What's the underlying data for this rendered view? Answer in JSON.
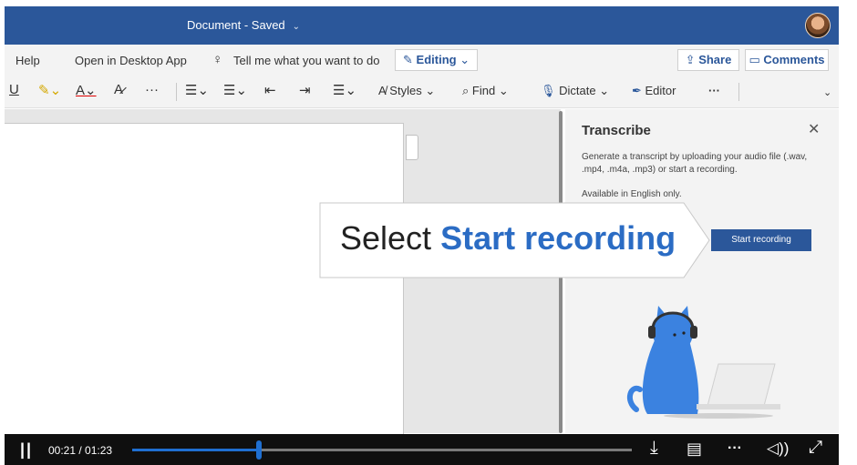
{
  "titlebar": {
    "doc_title": "Document - Saved",
    "chevron": "⌄"
  },
  "menu": {
    "help": "Help",
    "open_desktop": "Open in Desktop App",
    "tell_me": "Tell me what you want to do",
    "editing": "Editing",
    "share": "Share",
    "comments": "Comments"
  },
  "tools": {
    "styles": "Styles",
    "find": "Find",
    "dictate": "Dictate",
    "editor": "Editor",
    "more": "···"
  },
  "pane": {
    "title": "Transcribe",
    "close": "✕",
    "description": "Generate a transcript by uploading your audio file (.wav, .mp4, .m4a, .mp3) or start a recording.",
    "note": "Available in English only.",
    "start_button": "Start recording"
  },
  "callout": {
    "lead": "Select",
    "highlight": "Start recording"
  },
  "video": {
    "pause": "||",
    "time": "00:21 / 01:23",
    "progress": 0.253,
    "more": "···"
  },
  "colors": {
    "brand": "#2b579a",
    "accent": "#2b6cc4",
    "progress": "#1f6fd1"
  }
}
